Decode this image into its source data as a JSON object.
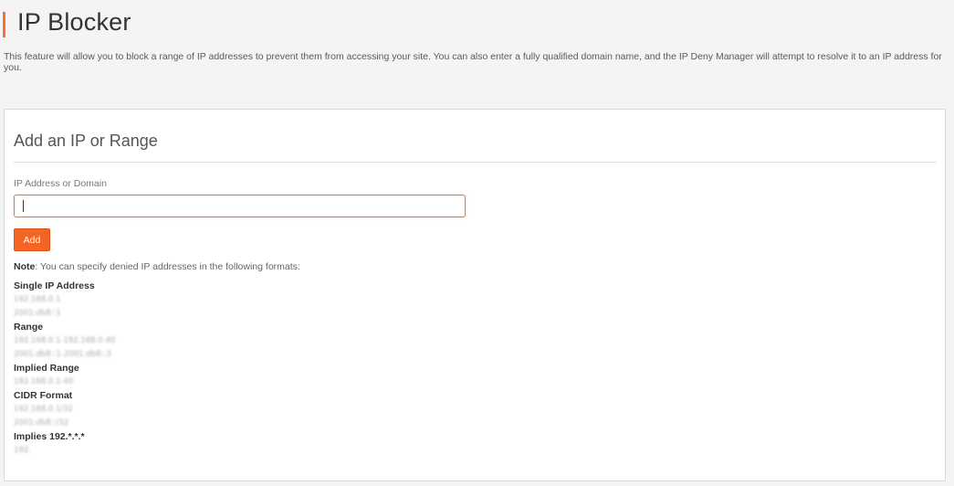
{
  "header": {
    "title": "IP Blocker",
    "description": "This feature will allow you to block a range of IP addresses to prevent them from accessing your site. You can also enter a fully qualified domain name, and the IP Deny Manager will attempt to resolve it to an IP address for you."
  },
  "form": {
    "title": "Add an IP or Range",
    "field_label": "IP Address or Domain",
    "input_value": "",
    "add_label": "Add"
  },
  "note": {
    "label": "Note",
    "text": ": You can specify denied IP addresses in the following formats:"
  },
  "formats": [
    {
      "heading": "Single IP Address",
      "examples": [
        "192.168.0.1",
        "2001:db8::1"
      ]
    },
    {
      "heading": "Range",
      "examples": [
        "192.168.0.1-192.168.0.40",
        "2001:db8::1-2001:db8::3"
      ]
    },
    {
      "heading": "Implied Range",
      "examples": [
        "192.168.0.1-40"
      ]
    },
    {
      "heading": "CIDR Format",
      "examples": [
        "192.168.0.1/32",
        "2001:db8::/32"
      ]
    },
    {
      "heading": "Implies 192.*.*.*",
      "examples": [
        "192."
      ]
    }
  ],
  "colors": {
    "accent": "#f26522",
    "accent_border": "#f2733a",
    "page_background": "#f4f4f4",
    "panel_background": "#ffffff"
  }
}
